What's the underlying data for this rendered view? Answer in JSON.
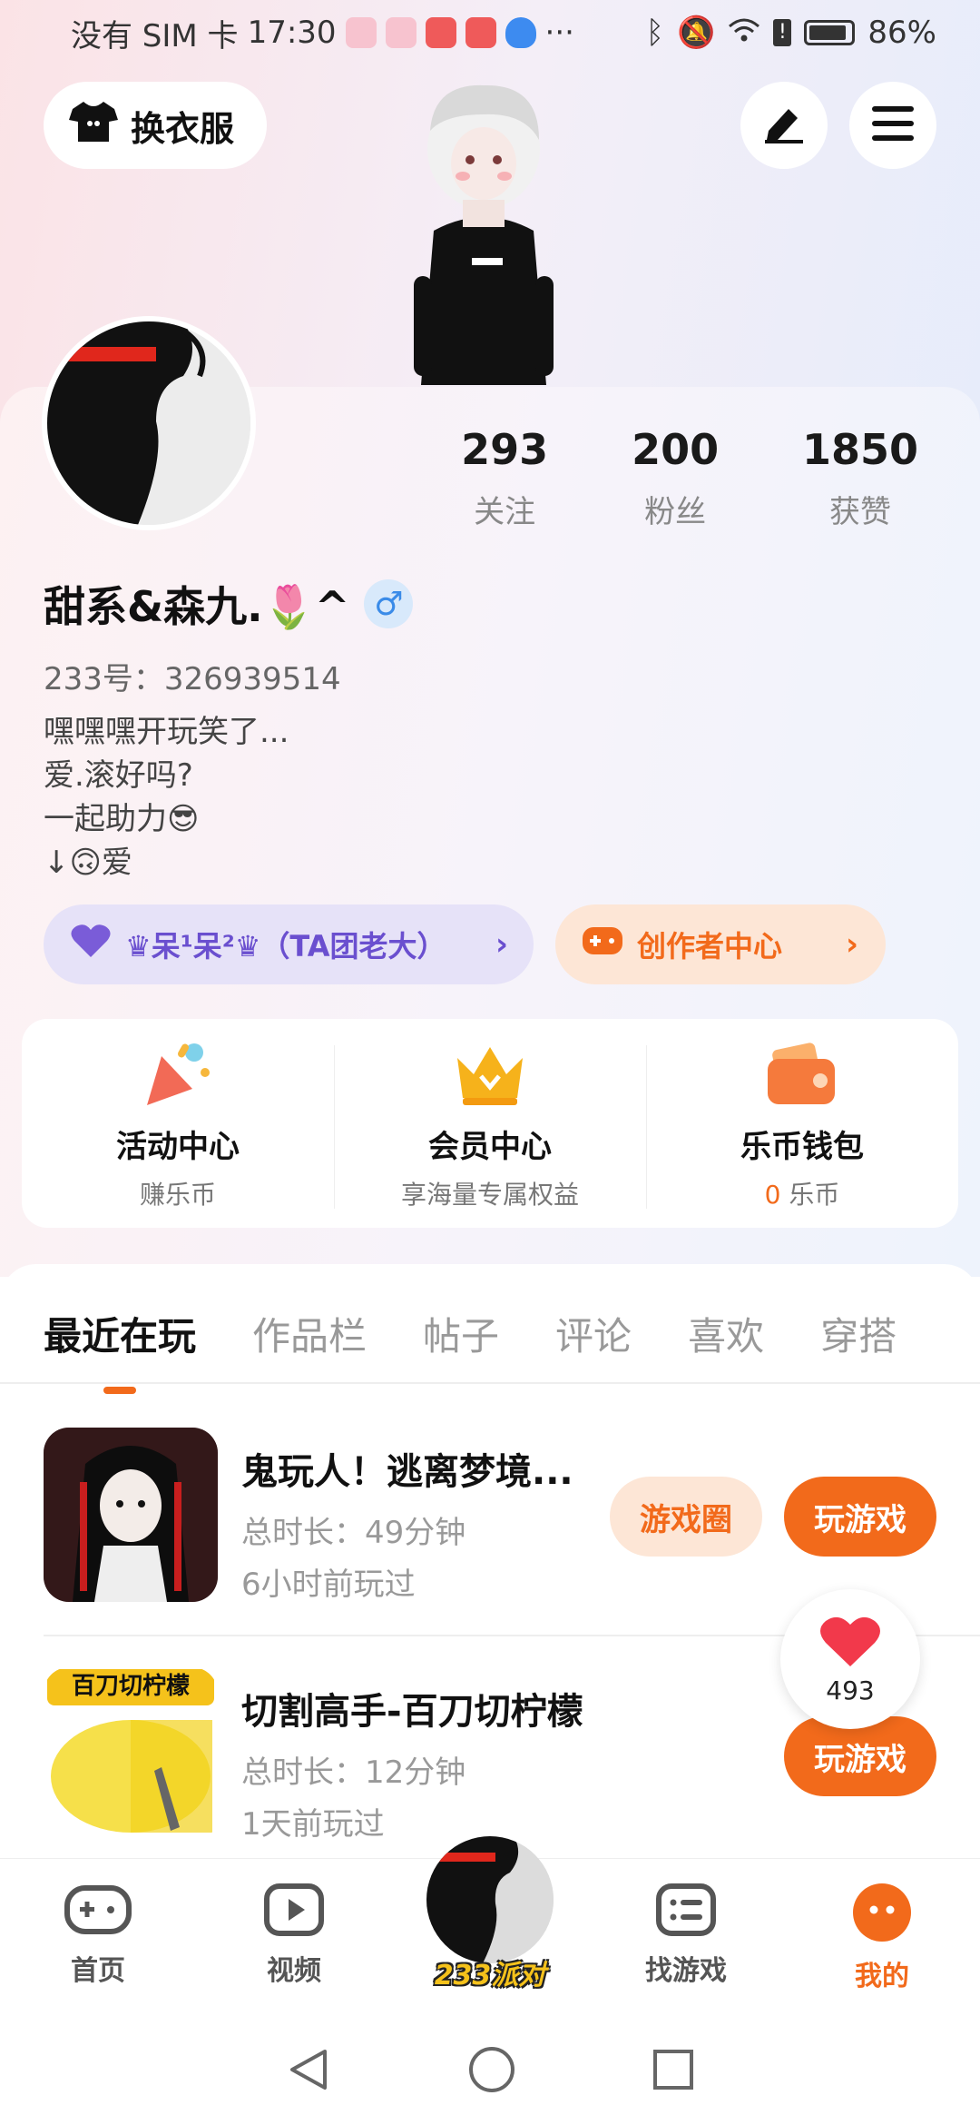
{
  "status_bar": {
    "carrier": "没有 SIM 卡",
    "time": "17:30",
    "more": "···",
    "battery": "86%"
  },
  "header": {
    "outfit_label": "换衣服",
    "edit_icon": "pen-icon",
    "menu_icon": "hamburger-menu-icon"
  },
  "profile": {
    "stats": [
      {
        "value": "293",
        "label": "关注"
      },
      {
        "value": "200",
        "label": "粉丝"
      },
      {
        "value": "1850",
        "label": "获赞"
      }
    ],
    "nickname": "甜系&森九.🌷^",
    "gender": "♂",
    "uid": "233号：326939514",
    "bio": [
      "嘿嘿嘿开玩笑了...",
      "爱.滚好吗?",
      "一起助力😎",
      "↓🙃爱"
    ],
    "team_pill": "♛呆¹呆²♛（TA团老大）",
    "creator_pill": "创作者中心"
  },
  "quick_actions": [
    {
      "title": "活动中心",
      "sub": "赚乐币"
    },
    {
      "title": "会员中心",
      "sub": "享海量专属权益"
    },
    {
      "title": "乐币钱包",
      "sub_value": "0",
      "sub_unit": "乐币"
    }
  ],
  "tabs": [
    "最近在玩",
    "作品栏",
    "帖子",
    "评论",
    "喜欢",
    "穿搭"
  ],
  "games": [
    {
      "title": "鬼玩人！逃离梦境...",
      "duration": "总时长：49分钟",
      "last_played": "6小时前玩过",
      "circle_btn": "游戏圈",
      "play_btn": "玩游戏"
    },
    {
      "title": "切割高手-百刀切柠檬",
      "thumb_label": "百刀切柠檬",
      "duration": "总时长：12分钟",
      "last_played": "1天前玩过",
      "play_btn": "玩游戏"
    }
  ],
  "like_bubble": {
    "count": "493"
  },
  "bottom_nav": [
    {
      "label": "首页",
      "icon": "gamepad-icon"
    },
    {
      "label": "视频",
      "icon": "video-play-icon"
    },
    {
      "label": "233派对",
      "icon": "party-avatar"
    },
    {
      "label": "找游戏",
      "icon": "list-icon"
    },
    {
      "label": "我的",
      "icon": "me-face-icon"
    }
  ],
  "colors": {
    "accent": "#f26a1b",
    "team_purple": "#6a4fcf",
    "gender_blue": "#3a8be8"
  }
}
